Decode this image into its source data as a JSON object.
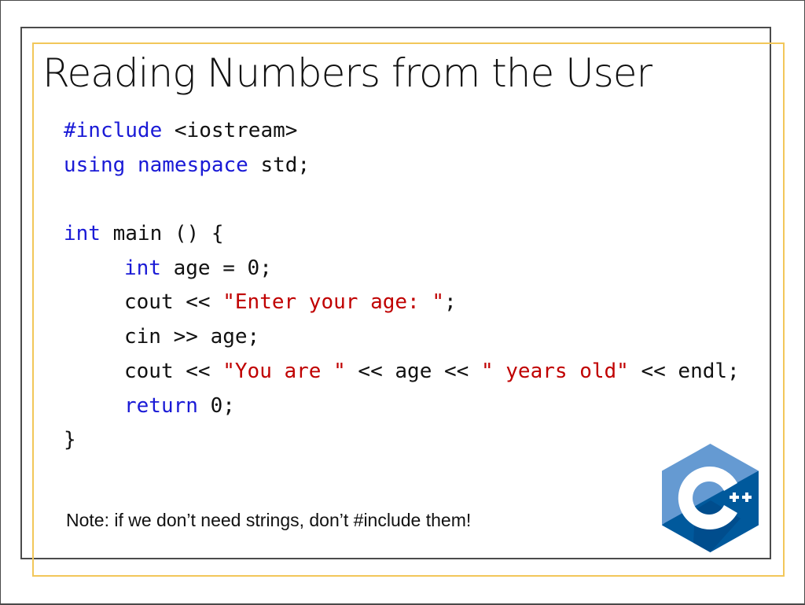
{
  "slide": {
    "title": "Reading Numbers from the User",
    "code_lines": [
      {
        "indent": false,
        "tokens": [
          {
            "t": "#include",
            "c": "kw"
          },
          {
            "t": " <iostream>",
            "c": ""
          }
        ]
      },
      {
        "indent": false,
        "tokens": [
          {
            "t": "using",
            "c": "kw"
          },
          {
            "t": " ",
            "c": ""
          },
          {
            "t": "namespace",
            "c": "kw"
          },
          {
            "t": " std;",
            "c": ""
          }
        ]
      },
      {
        "indent": false,
        "tokens": [
          {
            "t": "",
            "c": ""
          }
        ]
      },
      {
        "indent": false,
        "tokens": [
          {
            "t": "int",
            "c": "kw"
          },
          {
            "t": " main () {",
            "c": ""
          }
        ]
      },
      {
        "indent": true,
        "tokens": [
          {
            "t": "int",
            "c": "kw"
          },
          {
            "t": " age = 0;",
            "c": ""
          }
        ]
      },
      {
        "indent": true,
        "tokens": [
          {
            "t": "cout << ",
            "c": ""
          },
          {
            "t": "\"Enter your age: \"",
            "c": "str"
          },
          {
            "t": ";",
            "c": ""
          }
        ]
      },
      {
        "indent": true,
        "tokens": [
          {
            "t": "cin >> age;",
            "c": ""
          }
        ]
      },
      {
        "indent": true,
        "tokens": [
          {
            "t": "cout << ",
            "c": ""
          },
          {
            "t": "\"You are \"",
            "c": "str"
          },
          {
            "t": " << age << ",
            "c": ""
          },
          {
            "t": "\" years old\"",
            "c": "str"
          },
          {
            "t": " << endl;",
            "c": ""
          }
        ]
      },
      {
        "indent": true,
        "tokens": [
          {
            "t": "return",
            "c": "kw"
          },
          {
            "t": " 0;",
            "c": ""
          }
        ]
      },
      {
        "indent": false,
        "tokens": [
          {
            "t": "}",
            "c": ""
          }
        ]
      }
    ],
    "note": "Note: if we don’t need strings, don’t #include them!",
    "logo": {
      "icon": "cpp-logo-icon",
      "label": "C++"
    }
  },
  "colors": {
    "keyword": "#1a1ad6",
    "string": "#c00000",
    "accent_border": "#f2c75a",
    "logo_light": "#659ad2",
    "logo_dark": "#00599c",
    "logo_mid": "#004482"
  }
}
